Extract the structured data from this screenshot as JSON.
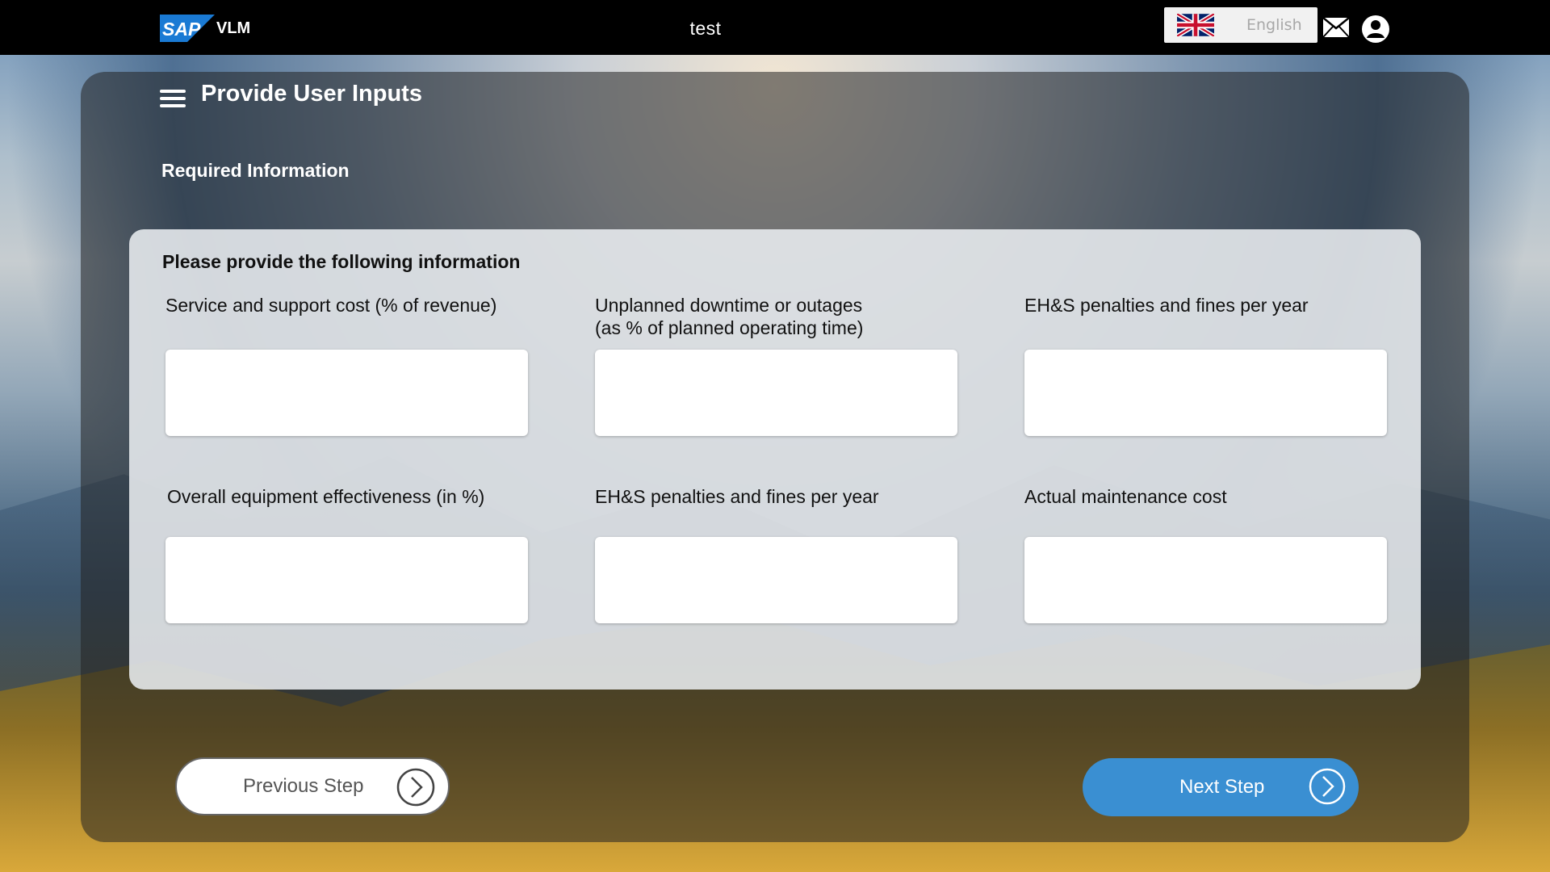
{
  "topbar": {
    "logo_text": "SAP",
    "product": "VLM",
    "title": "test",
    "language": "English"
  },
  "page": {
    "title": "Provide User Inputs",
    "section": "Required Information"
  },
  "form": {
    "heading": "Please provide the following information",
    "fields": [
      {
        "label": "Service and support cost (% of revenue)",
        "value": ""
      },
      {
        "label": "Unplanned downtime or outages\n(as % of planned operating time)",
        "value": ""
      },
      {
        "label": "EH&S penalties and fines per year",
        "value": ""
      },
      {
        "label": "Overall equipment effectiveness (in %)",
        "value": ""
      },
      {
        "label": "EH&S penalties and fines per year",
        "value": ""
      },
      {
        "label": "Actual maintenance cost",
        "value": ""
      }
    ]
  },
  "nav": {
    "previous": "Previous Step",
    "next": "Next Step"
  },
  "colors": {
    "accent": "#3a8fd2",
    "topbar": "#000000"
  }
}
